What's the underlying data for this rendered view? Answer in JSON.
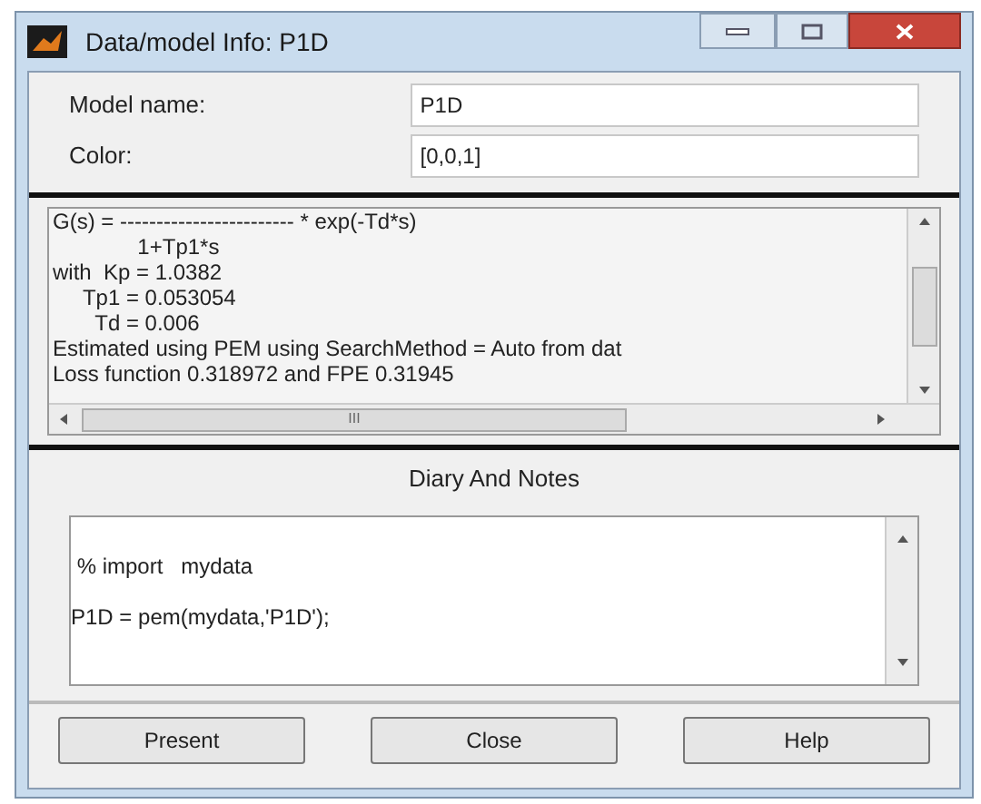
{
  "window": {
    "title": "Data/model Info: P1D"
  },
  "fields": [
    {
      "label": "Model name:",
      "value": "P1D"
    },
    {
      "label": "Color:",
      "value": "[0,0,1]"
    }
  ],
  "model_info": {
    "lines": [
      "G(s) = ------------------------ * exp(-Td*s)",
      "              1+Tp1*s",
      "with  Kp = 1.0382",
      "     Tp1 = 0.053054",
      "       Td = 0.006",
      "Estimated using PEM using SearchMethod = Auto from dat",
      "Loss function 0.318972 and FPE 0.31945"
    ],
    "horizontal_scroll_label": "III"
  },
  "notes": {
    "title": "Diary And Notes",
    "lines": [
      " % import   mydata",
      "P1D = pem(mydata,'P1D');"
    ]
  },
  "buttons": [
    "Present",
    "Close",
    "Help"
  ]
}
